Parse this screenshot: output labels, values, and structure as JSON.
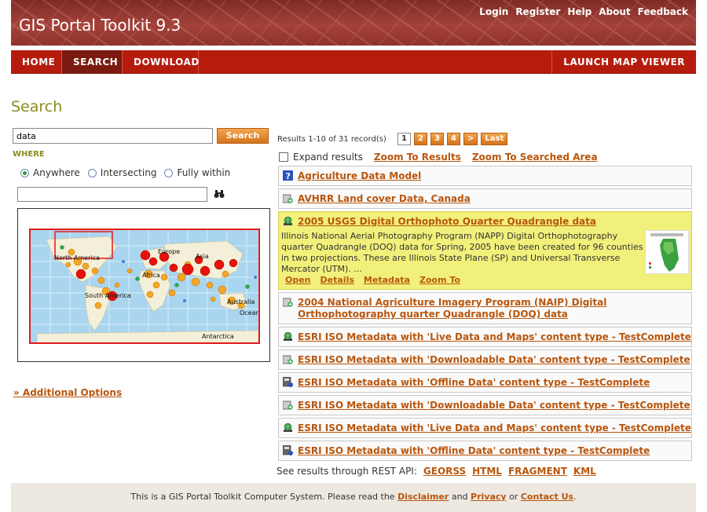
{
  "header": {
    "title": "GIS Portal Toolkit 9.3",
    "links": [
      "Login",
      "Register",
      "Help",
      "About",
      "Feedback"
    ]
  },
  "nav": {
    "tabs": [
      "HOME",
      "SEARCH",
      "DOWNLOAD"
    ],
    "active": "SEARCH",
    "launch": "LAUNCH MAP VIEWER"
  },
  "page_title": "Search",
  "search": {
    "value": "data",
    "button": "Search",
    "where_label": "WHERE",
    "options": [
      "Anywhere",
      "Intersecting",
      "Fully within"
    ],
    "selected": "Anywhere",
    "place_value": ""
  },
  "map": {
    "labels": [
      "North America",
      "Europe",
      "Asia",
      "Africa",
      "South America",
      "Australia",
      "Oceania",
      "Antarctica"
    ]
  },
  "additional_options": "» Additional Options",
  "results": {
    "summary": "Results 1-10 of 31 record(s)",
    "pages": [
      "1",
      "2",
      "3",
      "4",
      ">",
      "Last"
    ],
    "current_page": "1",
    "expand_label": "Expand results",
    "zoom_results": "Zoom To Results",
    "zoom_area": "Zoom To Searched Area",
    "items": [
      {
        "title": "Agriculture Data Model",
        "icon": "question-icon"
      },
      {
        "title": "AVHRR Land cover Data, Canada",
        "icon": "add-layer-icon"
      },
      {
        "title": "2005 USGS Digital Orthophoto Quarter Quadrangle data",
        "icon": "live-map-icon",
        "description": "Illinois National Aerial Photography Program (NAPP) Digital Orthophotography quarter Quadrangle (DOQ) data for Spring, 2005 have been created for 96 counties in two projections. These are Illinois State Plane (SP) and Universal Transverse Mercator (UTM). ...",
        "links": [
          "Open",
          "Details",
          "Metadata",
          "Zoom To"
        ]
      },
      {
        "title": "2004 National Agriculture Imagery Program (NAIP) Digital Orthophotography quarter Quadrangle (DOQ) data",
        "icon": "add-layer-icon"
      },
      {
        "title": "ESRI ISO Metadata with 'Live Data and Maps' content type - TestComplete",
        "icon": "live-map-icon"
      },
      {
        "title": "ESRI ISO Metadata with 'Downloadable Data' content type - TestComplete",
        "icon": "add-layer-icon"
      },
      {
        "title": "ESRI ISO Metadata with 'Offline Data' content type - TestComplete",
        "icon": "offline-icon"
      },
      {
        "title": "ESRI ISO Metadata with 'Downloadable Data' content type - TestComplete",
        "icon": "add-layer-icon"
      },
      {
        "title": "ESRI ISO Metadata with 'Live Data and Maps' content type - TestComplete",
        "icon": "live-map-icon"
      },
      {
        "title": "ESRI ISO Metadata with 'Offline Data' content type - TestComplete",
        "icon": "offline-icon"
      }
    ]
  },
  "rest": {
    "label": "See results through REST API:",
    "links": [
      "GEORSS",
      "HTML",
      "FRAGMENT",
      "KML"
    ]
  },
  "footer": {
    "prefix": "This is a GIS Portal Toolkit Computer System. Please read the",
    "disclaimer": "Disclaimer",
    "and": "and",
    "privacy": "Privacy",
    "or": "or",
    "contact": "Contact Us",
    "end": "."
  }
}
